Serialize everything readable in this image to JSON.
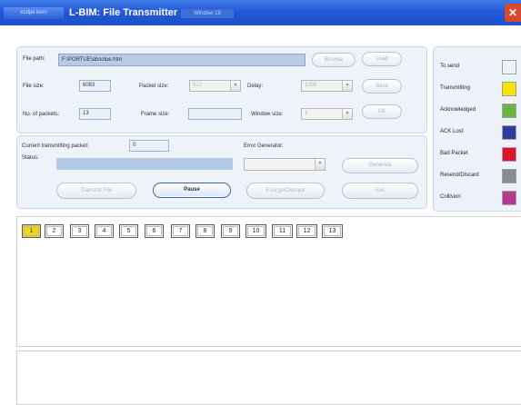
{
  "window": {
    "badge": "ezdpe kern",
    "title": "L-BIM: File Transmitter",
    "subtitle": "Window 18",
    "close_icon": "close-icon"
  },
  "file": {
    "file_path_label": "File path:",
    "file_path_value": "F:\\PORTUE\\absolue.htm",
    "browse_label": "Browse",
    "load_label": "Load",
    "file_size_label": "File size:",
    "file_size_value": "6083",
    "packet_size_label": "Packet size:",
    "packet_size_value": "512",
    "delay_label": "Delay:",
    "delay_value": "1000",
    "save_label": "Save",
    "num_packets_label": "No. of packets:",
    "num_packets_value": "13",
    "frame_size_label": "Frame size:",
    "frame_size_value": "",
    "window_size_label": "Window size:",
    "window_size_value": "1",
    "ok_label": "OK"
  },
  "transmit": {
    "current_packet_label": "Current transmitting packet:",
    "current_packet_value": "0",
    "status_label": "Status:",
    "status_value": "",
    "error_generator_label": "Error Generator:",
    "error_generator_value": "",
    "generate_label": "Generate",
    "transmit_label": "Transmit File",
    "pause_label": "Pause",
    "encrypt_label": "Encrypt/Decrypt",
    "exit_label": "Exit"
  },
  "legend": [
    {
      "label": "To send",
      "color": "#f0f0f0"
    },
    {
      "label": "Transmitting",
      "color": "#f4e400"
    },
    {
      "label": "Acknowledged",
      "color": "#6cb43f"
    },
    {
      "label": "ACK Lost",
      "color": "#2b3f9a"
    },
    {
      "label": "Bad Packet",
      "color": "#e0152c"
    },
    {
      "label": "Resend/Discard",
      "color": "#8b8b8b"
    },
    {
      "label": "Collision",
      "color": "#b8398f"
    }
  ],
  "packets": [
    {
      "label": "1",
      "state": "Transmitting"
    },
    {
      "label": "2",
      "state": "To send"
    },
    {
      "label": "3",
      "state": "To send"
    },
    {
      "label": "4",
      "state": "To send"
    },
    {
      "label": "5",
      "state": "To send"
    },
    {
      "label": "6",
      "state": "To send"
    },
    {
      "label": "7",
      "state": "To send"
    },
    {
      "label": "8",
      "state": "To send"
    },
    {
      "label": "9",
      "state": "To send"
    },
    {
      "label": "10",
      "state": "To send"
    },
    {
      "label": "11",
      "state": "To send"
    },
    {
      "label": "12",
      "state": "To send"
    },
    {
      "label": "13",
      "state": "To send"
    }
  ]
}
